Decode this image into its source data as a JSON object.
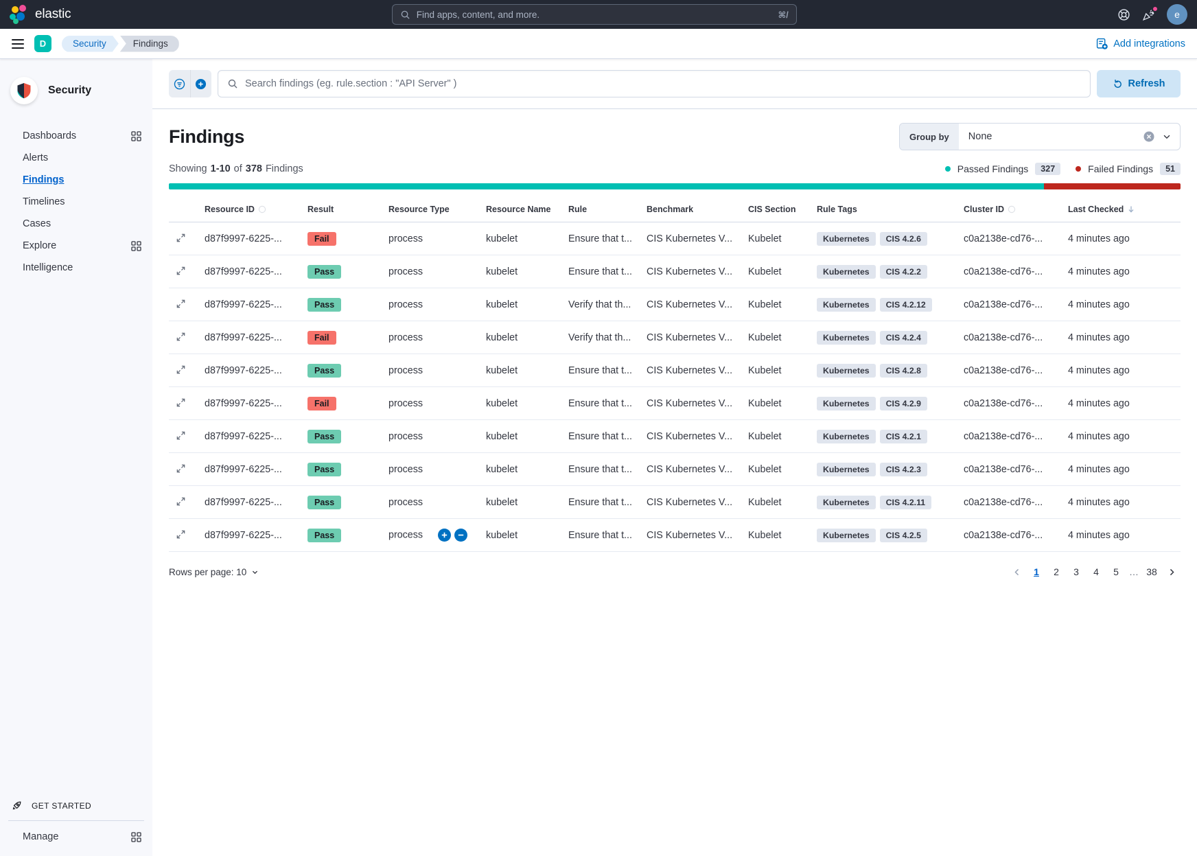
{
  "header": {
    "logo_text": "elastic",
    "search_placeholder": "Find apps, content, and more.",
    "search_shortcut": "⌘/",
    "avatar_initial": "e"
  },
  "nav": {
    "space_initial": "D",
    "breadcrumb_security": "Security",
    "breadcrumb_findings": "Findings",
    "add_integrations_label": "Add integrations"
  },
  "sidebar": {
    "title": "Security",
    "items": [
      {
        "label": "Dashboards",
        "grid": true,
        "active": false
      },
      {
        "label": "Alerts",
        "grid": false,
        "active": false
      },
      {
        "label": "Findings",
        "grid": false,
        "active": true
      },
      {
        "label": "Timelines",
        "grid": false,
        "active": false
      },
      {
        "label": "Cases",
        "grid": false,
        "active": false
      },
      {
        "label": "Explore",
        "grid": true,
        "active": false
      },
      {
        "label": "Intelligence",
        "grid": false,
        "active": false
      }
    ],
    "get_started_label": "GET STARTED",
    "manage_label": "Manage"
  },
  "toolbar": {
    "search_placeholder": "Search findings (eg. rule.section : \"API Server\" )",
    "refresh_label": "Refresh"
  },
  "page": {
    "title": "Findings",
    "group_by_label": "Group by",
    "group_by_value": "None"
  },
  "summary": {
    "showing_prefix": "Showing",
    "range": "1-10",
    "of": "of",
    "total": "378",
    "suffix": "Findings",
    "passed_label": "Passed Findings",
    "passed_count": "327",
    "failed_label": "Failed Findings",
    "failed_count": "51"
  },
  "colors": {
    "passed": "#00BFB3",
    "failed": "#BD271E",
    "pass_badge": "#6DCCB1",
    "fail_badge": "#F6726A",
    "primary": "#0071C2"
  },
  "table": {
    "columns": [
      {
        "label": "",
        "sort": "none"
      },
      {
        "label": "Resource ID",
        "sort": "ghost"
      },
      {
        "label": "Result",
        "sort": "none"
      },
      {
        "label": "Resource Type",
        "sort": "none"
      },
      {
        "label": "Resource Name",
        "sort": "none"
      },
      {
        "label": "Rule",
        "sort": "none"
      },
      {
        "label": "Benchmark",
        "sort": "none"
      },
      {
        "label": "CIS Section",
        "sort": "none"
      },
      {
        "label": "Rule Tags",
        "sort": "none"
      },
      {
        "label": "Cluster ID",
        "sort": "ghost"
      },
      {
        "label": "Last Checked",
        "sort": "desc"
      }
    ],
    "rows": [
      {
        "resource_id": "d87f9997-6225-...",
        "result": "Fail",
        "resource_type": "process",
        "resource_name": "kubelet",
        "rule": "Ensure that t...",
        "benchmark": "CIS Kubernetes V...",
        "cis_section": "Kubelet",
        "tags": [
          "Kubernetes",
          "CIS 4.2.6"
        ],
        "cluster_id": "c0a2138e-cd76-...",
        "last_checked": "4 minutes ago",
        "has_actions": false
      },
      {
        "resource_id": "d87f9997-6225-...",
        "result": "Pass",
        "resource_type": "process",
        "resource_name": "kubelet",
        "rule": "Ensure that t...",
        "benchmark": "CIS Kubernetes V...",
        "cis_section": "Kubelet",
        "tags": [
          "Kubernetes",
          "CIS 4.2.2"
        ],
        "cluster_id": "c0a2138e-cd76-...",
        "last_checked": "4 minutes ago",
        "has_actions": false
      },
      {
        "resource_id": "d87f9997-6225-...",
        "result": "Pass",
        "resource_type": "process",
        "resource_name": "kubelet",
        "rule": "Verify that th...",
        "benchmark": "CIS Kubernetes V...",
        "cis_section": "Kubelet",
        "tags": [
          "Kubernetes",
          "CIS 4.2.12"
        ],
        "cluster_id": "c0a2138e-cd76-...",
        "last_checked": "4 minutes ago",
        "has_actions": false
      },
      {
        "resource_id": "d87f9997-6225-...",
        "result": "Fail",
        "resource_type": "process",
        "resource_name": "kubelet",
        "rule": "Verify that th...",
        "benchmark": "CIS Kubernetes V...",
        "cis_section": "Kubelet",
        "tags": [
          "Kubernetes",
          "CIS 4.2.4"
        ],
        "cluster_id": "c0a2138e-cd76-...",
        "last_checked": "4 minutes ago",
        "has_actions": false
      },
      {
        "resource_id": "d87f9997-6225-...",
        "result": "Pass",
        "resource_type": "process",
        "resource_name": "kubelet",
        "rule": "Ensure that t...",
        "benchmark": "CIS Kubernetes V...",
        "cis_section": "Kubelet",
        "tags": [
          "Kubernetes",
          "CIS 4.2.8"
        ],
        "cluster_id": "c0a2138e-cd76-...",
        "last_checked": "4 minutes ago",
        "has_actions": false
      },
      {
        "resource_id": "d87f9997-6225-...",
        "result": "Fail",
        "resource_type": "process",
        "resource_name": "kubelet",
        "rule": "Ensure that t...",
        "benchmark": "CIS Kubernetes V...",
        "cis_section": "Kubelet",
        "tags": [
          "Kubernetes",
          "CIS 4.2.9"
        ],
        "cluster_id": "c0a2138e-cd76-...",
        "last_checked": "4 minutes ago",
        "has_actions": false
      },
      {
        "resource_id": "d87f9997-6225-...",
        "result": "Pass",
        "resource_type": "process",
        "resource_name": "kubelet",
        "rule": "Ensure that t...",
        "benchmark": "CIS Kubernetes V...",
        "cis_section": "Kubelet",
        "tags": [
          "Kubernetes",
          "CIS 4.2.1"
        ],
        "cluster_id": "c0a2138e-cd76-...",
        "last_checked": "4 minutes ago",
        "has_actions": false
      },
      {
        "resource_id": "d87f9997-6225-...",
        "result": "Pass",
        "resource_type": "process",
        "resource_name": "kubelet",
        "rule": "Ensure that t...",
        "benchmark": "CIS Kubernetes V...",
        "cis_section": "Kubelet",
        "tags": [
          "Kubernetes",
          "CIS 4.2.3"
        ],
        "cluster_id": "c0a2138e-cd76-...",
        "last_checked": "4 minutes ago",
        "has_actions": false
      },
      {
        "resource_id": "d87f9997-6225-...",
        "result": "Pass",
        "resource_type": "process",
        "resource_name": "kubelet",
        "rule": "Ensure that t...",
        "benchmark": "CIS Kubernetes V...",
        "cis_section": "Kubelet",
        "tags": [
          "Kubernetes",
          "CIS 4.2.11"
        ],
        "cluster_id": "c0a2138e-cd76-...",
        "last_checked": "4 minutes ago",
        "has_actions": false
      },
      {
        "resource_id": "d87f9997-6225-...",
        "result": "Pass",
        "resource_type": "process",
        "resource_name": "kubelet",
        "rule": "Ensure that t...",
        "benchmark": "CIS Kubernetes V...",
        "cis_section": "Kubelet",
        "tags": [
          "Kubernetes",
          "CIS 4.2.5"
        ],
        "cluster_id": "c0a2138e-cd76-...",
        "last_checked": "4 minutes ago",
        "has_actions": true
      }
    ]
  },
  "pagination": {
    "rows_per_page_label": "Rows per page: 10",
    "pages": [
      "1",
      "2",
      "3",
      "4",
      "5",
      "...",
      "38"
    ],
    "active_page": "1"
  }
}
